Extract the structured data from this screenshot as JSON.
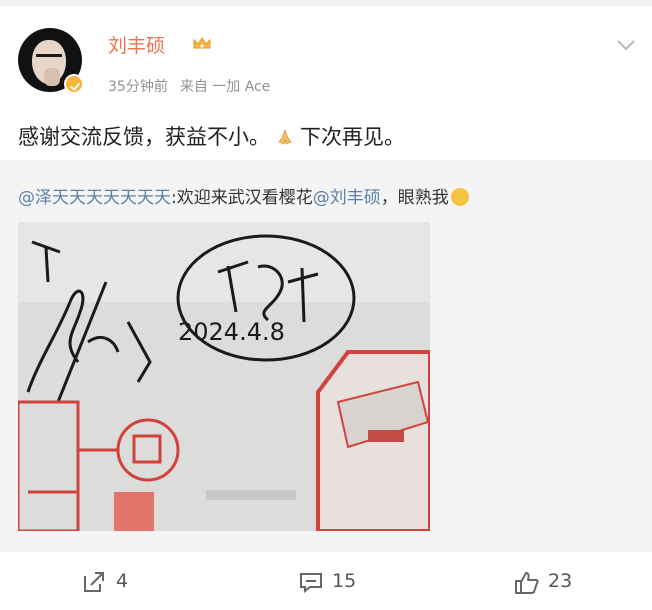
{
  "post": {
    "author": {
      "name": "刘丰硕",
      "icons": {
        "avatar": "avatar-image",
        "verified": "verified-badge-icon",
        "vip": "crown-icon"
      }
    },
    "time": "35分钟前",
    "source": "来自 一加 Ace",
    "text": "感谢交流反馈，获益不小。",
    "text_after_emoji": "下次再见。",
    "emoji": "pray-hands-icon"
  },
  "repost": {
    "mention_user": "@泽天天天天天天天",
    "message": ":欢迎来武汉看樱花",
    "mention_author": "@刘丰硕",
    "message_tail": "，眼熟我",
    "emoji": "grin-face-icon",
    "image": {
      "signature_text": "2024.4.8",
      "icon": "signed-photo-image"
    }
  },
  "actions": {
    "repost_count": "4",
    "comment_count": "15",
    "like_count": "23"
  },
  "colors": {
    "username": "#eb7350",
    "mention": "#5b81a8",
    "repost_bg": "#f4f4f4",
    "secondary_text": "#939393"
  }
}
